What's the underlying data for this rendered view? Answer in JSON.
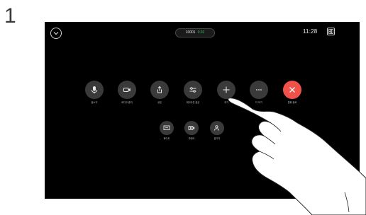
{
  "step": {
    "number": "1"
  },
  "top_bar": {
    "call_number": "10001",
    "call_duration": "0:02",
    "clock": "11:28"
  },
  "controls": {
    "mute": "음소거",
    "stop_video": "비디오 중지",
    "share": "공유",
    "layout_options": "레이아웃 옵션",
    "add": "추가",
    "more": "더 보기",
    "end_call": "통화 종료"
  },
  "secondary_controls": {
    "whiteboard": "화이트",
    "camera": "카메라",
    "participants": "참가자"
  },
  "icons": {
    "chevron": "chevron-down-icon",
    "layout": "layout-icon",
    "mic": "microphone-icon",
    "video": "video-camera-icon",
    "share": "share-icon",
    "layout_options": "sliders-icon",
    "add": "plus-icon",
    "more": "ellipsis-icon",
    "end": "close-icon",
    "whiteboard": "whiteboard-icon",
    "camera": "camera-icon",
    "participants": "participants-icon"
  },
  "colors": {
    "screen_bg": "#000000",
    "button_bg": "#3a3a3a",
    "end_call": "#f0524a",
    "duration": "#2fbf6a"
  }
}
